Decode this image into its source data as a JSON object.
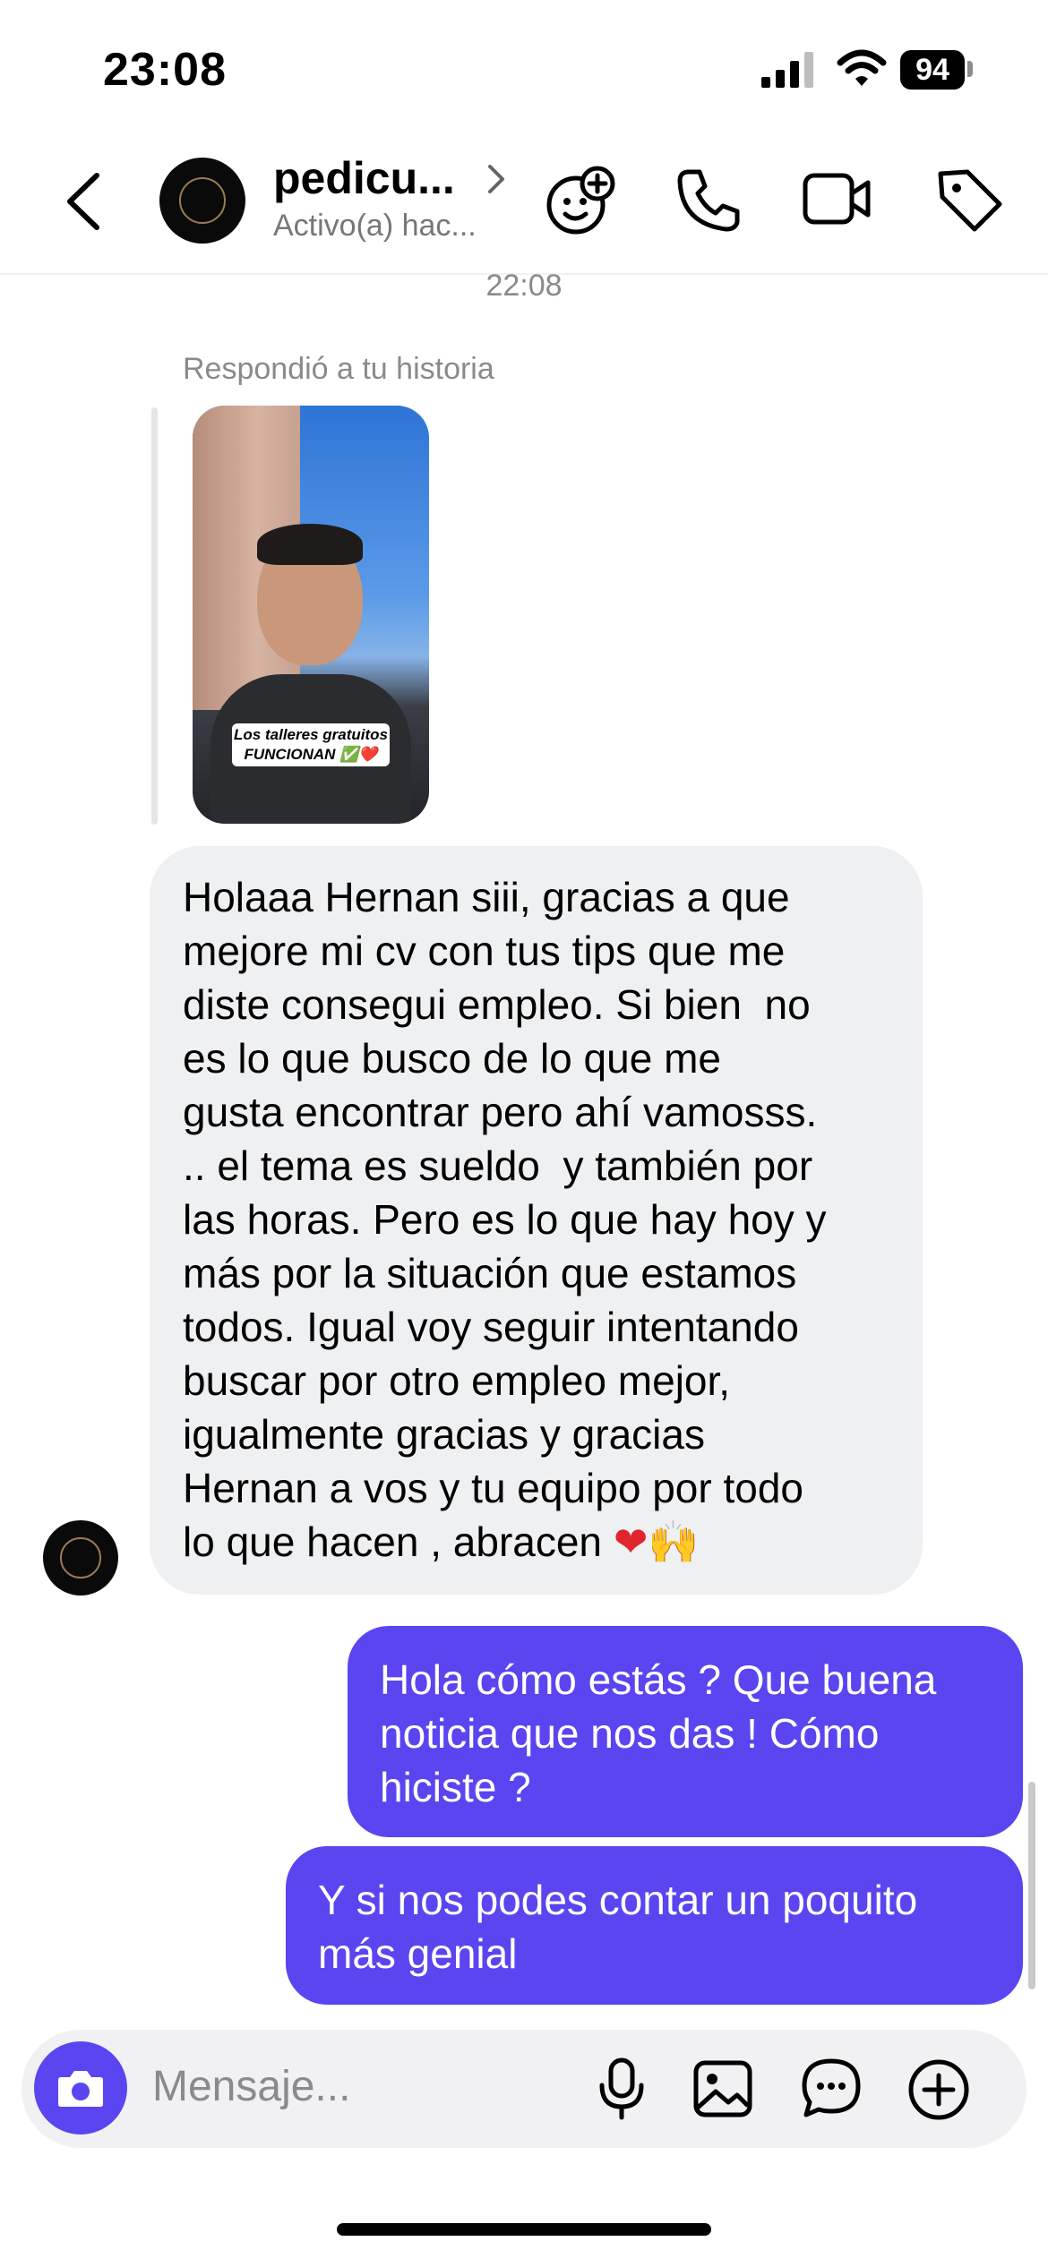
{
  "status_bar": {
    "time": "23:08",
    "battery": "94"
  },
  "header": {
    "name": "pedicu...",
    "status": "Activo(a) hac..."
  },
  "chat": {
    "timestamp": "22:08",
    "story_reply_label": "Respondió a tu historia",
    "story_caption_line1": "Los talleres gratuitos",
    "story_caption_line2": "FUNCIONAN ✅❤️",
    "incoming_message": "Holaaa Hernan siii, gracias a que\nmejore mi cv con tus tips que me\ndiste consegui empleo. Si bien  no\nes lo que busco de lo que me\ngusta encontrar pero ahí vamosss.\n.. el tema es sueldo  y también por\nlas horas. Pero es lo que hay hoy y\nmás por la situación que estamos\ntodos. Igual voy seguir intentando\nbuscar por otro empleo mejor,\nigualmente gracias y gracias\nHernan a vos y tu equipo por todo\nlo que hacen , abracen ",
    "incoming_emoji_heart": "❤",
    "incoming_emoji_hands": "🙌",
    "outgoing_messages": [
      "Hola cómo estás ? Que buena\nnoticia que nos das ! Cómo\nhiciste ?",
      "Y si nos podes contar un poquito\nmás genial"
    ]
  },
  "composer": {
    "placeholder": "Mensaje..."
  },
  "icons": {
    "back": "chevron-left-icon",
    "header_chevron": "chevron-right-icon",
    "effects": "face-sparkle-icon",
    "call": "phone-icon",
    "video": "video-camera-icon",
    "tag": "tag-icon",
    "camera": "camera-icon",
    "mic": "microphone-icon",
    "gallery": "image-icon",
    "sticker": "chat-bubble-icon",
    "more": "plus-circle-icon"
  },
  "colors": {
    "accent": "#5a45f0",
    "incoming_bubble": "#eff0f2",
    "muted_text": "#8a8a8a"
  }
}
